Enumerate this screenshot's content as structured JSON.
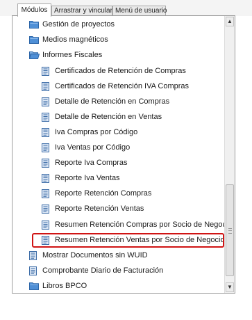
{
  "tabs": [
    {
      "label": "Módulos",
      "active": true
    },
    {
      "label": "Arrastrar y vincular",
      "active": false
    },
    {
      "label": "Menú de usuario",
      "active": false
    }
  ],
  "tree": {
    "folders_top": [
      {
        "label": "Gestión de proyectos",
        "icon": "folder-closed-icon"
      },
      {
        "label": "Medios magnéticos",
        "icon": "folder-closed-icon"
      },
      {
        "label": "Informes Fiscales",
        "icon": "folder-open-icon"
      }
    ],
    "reports": [
      "Certificados de Retención de Compras",
      "Certificados de Retención IVA Compras",
      "Detalle de Retención en Compras",
      "Detalle de Retención en Ventas",
      "Iva Compras por Código",
      "Iva Ventas por Código",
      "Reporte Iva Compras",
      "Reporte Iva Ventas",
      "Reporte Retención Compras",
      "Reporte Retención Ventas",
      "Resumen Retención Compras por Socio de Negocio",
      "Resumen Retención Ventas  por Socio de Negocio"
    ],
    "bottom_items": [
      {
        "label": "Mostrar Documentos sin WUID",
        "icon": "document-icon"
      },
      {
        "label": "Comprobante Diario de Facturación",
        "icon": "document-icon"
      },
      {
        "label": "Libros BPCO",
        "icon": "folder-closed-icon"
      }
    ],
    "highlighted_index": 11
  },
  "colors": {
    "folder": "#4f8fd6",
    "document": "#3f6ea8",
    "highlight": "#d01414"
  }
}
